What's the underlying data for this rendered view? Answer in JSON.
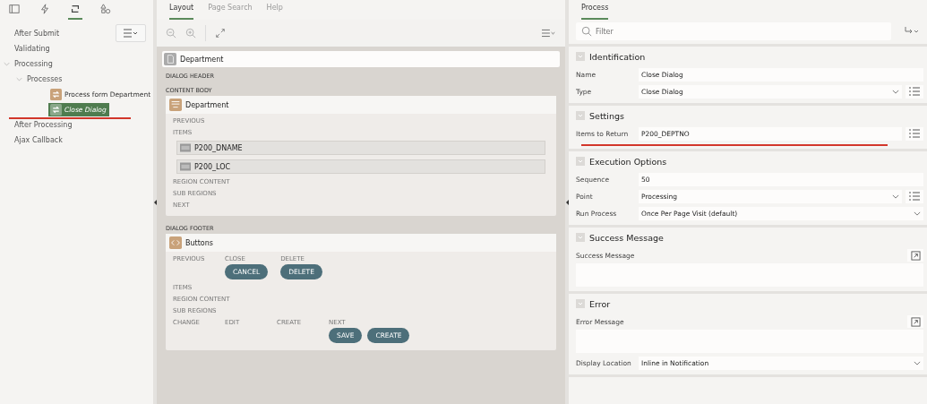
{
  "left_panel": {
    "tabs": [
      {
        "kind": "rendering",
        "selected": false
      },
      {
        "kind": "dynamic-actions",
        "selected": false
      },
      {
        "kind": "processing",
        "selected": true
      },
      {
        "kind": "shared",
        "selected": false
      }
    ],
    "tree": [
      {
        "label": "After Submit"
      },
      {
        "label": "Validating"
      },
      {
        "label": "Processing",
        "expanded": true,
        "children": [
          {
            "label": "Processes",
            "expanded": true,
            "children": [
              {
                "label": "Process form Department",
                "kind": "process",
                "selected": false
              },
              {
                "label": "Close Dialog",
                "kind": "process",
                "selected": true
              }
            ]
          }
        ]
      },
      {
        "label": "After Processing"
      },
      {
        "label": "Ajax Callback"
      }
    ]
  },
  "layout_panel": {
    "tabs": [
      {
        "label": "Layout",
        "selected": true
      },
      {
        "label": "Page Search",
        "selected": false
      },
      {
        "label": "Help",
        "selected": false
      }
    ],
    "page": {
      "title": "Department"
    },
    "positions": [
      {
        "label": "DIALOG HEADER"
      },
      {
        "label": "CONTENT BODY",
        "region": {
          "title": "Department",
          "kind": "form",
          "slots": [
            {
              "label": "PREVIOUS"
            },
            {
              "label": "ITEMS",
              "items": [
                "P200_DNAME",
                "P200_LOC"
              ]
            },
            {
              "label": "REGION CONTENT"
            },
            {
              "label": "SUB REGIONS"
            },
            {
              "label": "NEXT"
            }
          ]
        }
      },
      {
        "label": "DIALOG FOOTER",
        "region": {
          "title": "Buttons",
          "kind": "static",
          "button_rows": [
            [
              {
                "label": "PREVIOUS"
              },
              {
                "label": "CLOSE",
                "buttons": [
                  "CANCEL"
                ]
              },
              {
                "label": "DELETE",
                "buttons": [
                  "DELETE"
                ]
              }
            ]
          ],
          "slots": [
            {
              "label": "ITEMS"
            },
            {
              "label": "REGION CONTENT"
            },
            {
              "label": "SUB REGIONS"
            }
          ],
          "bottom_row": [
            {
              "label": "CHANGE"
            },
            {
              "label": "EDIT"
            },
            {
              "label": "CREATE"
            },
            {
              "label": "NEXT",
              "buttons": [
                "SAVE",
                "CREATE"
              ]
            }
          ]
        }
      }
    ]
  },
  "property_panel": {
    "tab": {
      "label": "Process",
      "selected": true
    },
    "filter": {
      "placeholder": "Filter"
    },
    "sections": [
      {
        "title": "Identification",
        "fields": [
          {
            "label": "Name",
            "kind": "text",
            "value": "Close Dialog"
          },
          {
            "label": "Type",
            "kind": "select",
            "value": "Close Dialog",
            "list_button": true
          }
        ]
      },
      {
        "title": "Settings",
        "fields": [
          {
            "label": "Items to Return",
            "kind": "text",
            "value": "P200_DEPTNO",
            "list_button": true
          }
        ]
      },
      {
        "title": "Execution Options",
        "fields": [
          {
            "label": "Sequence",
            "kind": "text",
            "value": "50"
          },
          {
            "label": "Point",
            "kind": "select",
            "value": "Processing",
            "list_button": true
          },
          {
            "label": "Run Process",
            "kind": "select",
            "value": "Once Per Page Visit (default)"
          }
        ]
      },
      {
        "title": "Success Message",
        "fields": [
          {
            "label": "Success Message",
            "kind": "textarea"
          }
        ]
      },
      {
        "title": "Error",
        "fields": [
          {
            "label": "Error Message",
            "kind": "textarea"
          },
          {
            "label": "Display Location",
            "kind": "select",
            "value": "Inline in Notification"
          }
        ]
      }
    ]
  }
}
